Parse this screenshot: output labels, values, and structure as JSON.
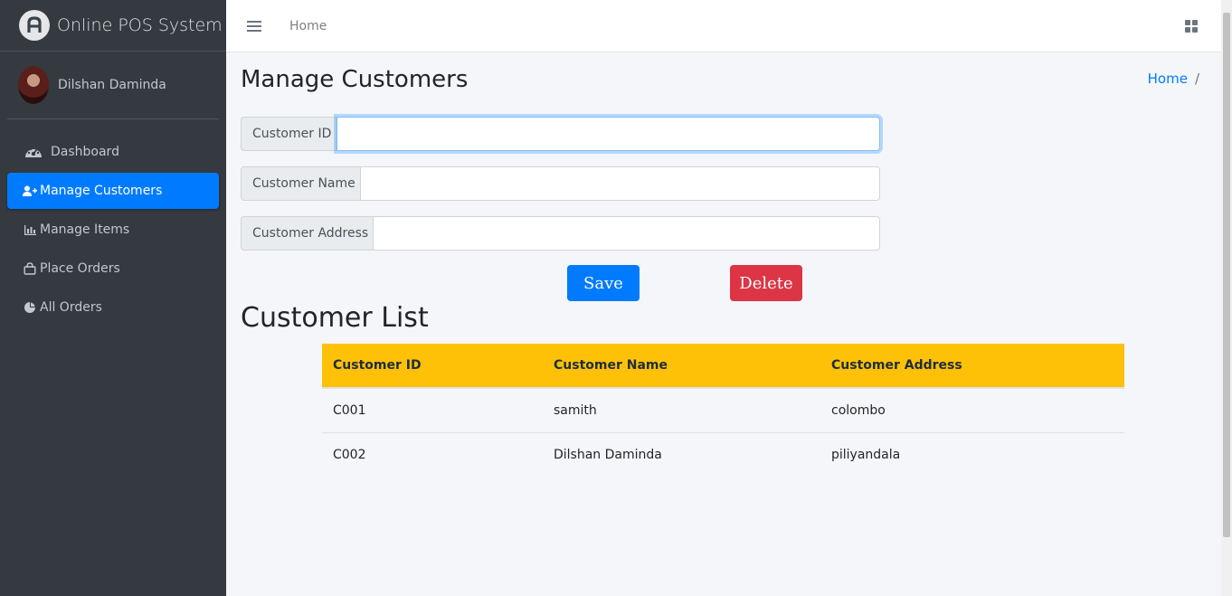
{
  "brand": {
    "title": "Online POS System",
    "logo_icon": "pos-logo-icon"
  },
  "user": {
    "name": "Dilshan Daminda"
  },
  "sidebar": {
    "items": [
      {
        "label": "Dashboard",
        "icon": "dashboard-gauge-icon",
        "active": false
      },
      {
        "label": "Manage Customers",
        "icon": "user-plus-icon",
        "active": true
      },
      {
        "label": "Manage Items",
        "icon": "bar-chart-icon",
        "active": false
      },
      {
        "label": "Place Orders",
        "icon": "shopping-bag-icon",
        "active": false
      },
      {
        "label": "All Orders",
        "icon": "pie-chart-icon",
        "active": false
      }
    ]
  },
  "topbar": {
    "home_link": "Home",
    "menu_icon": "hamburger-icon",
    "apps_icon": "grid-icon"
  },
  "page": {
    "title": "Manage Customers",
    "breadcrumb": {
      "home": "Home",
      "separator": "/"
    }
  },
  "form": {
    "customer_id": {
      "label": "Customer ID",
      "value": "",
      "placeholder": ""
    },
    "customer_name": {
      "label": "Customer Name",
      "value": "",
      "placeholder": ""
    },
    "customer_address": {
      "label": "Customer Address",
      "value": "",
      "placeholder": ""
    },
    "save_label": "Save",
    "delete_label": "Delete"
  },
  "customer_list": {
    "title": "Customer List",
    "columns": [
      "Customer ID",
      "Customer Name",
      "Customer Address"
    ],
    "rows": [
      [
        "C001",
        "samith",
        "colombo"
      ],
      [
        "C002",
        "Dilshan Daminda",
        "piliyandala"
      ]
    ]
  },
  "colors": {
    "sidebar_bg": "#343a40",
    "accent": "#007bff",
    "danger": "#dc3545",
    "table_header": "#ffc107"
  }
}
